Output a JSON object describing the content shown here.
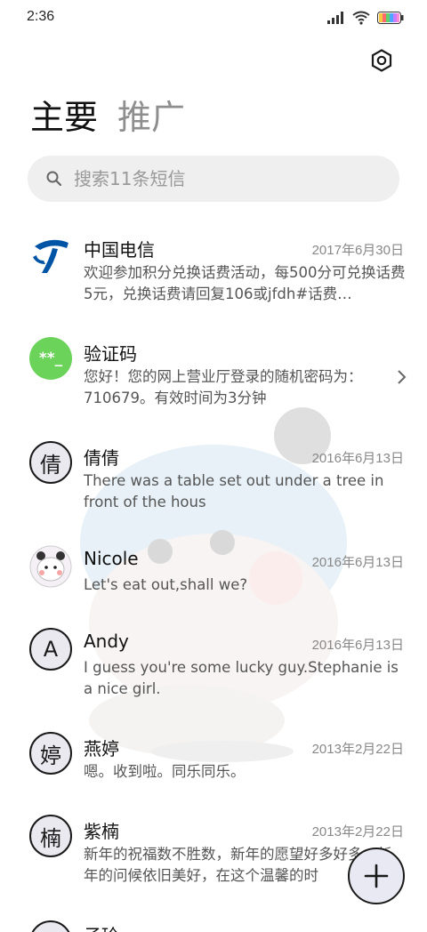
{
  "status_bar": {
    "time": "2:36"
  },
  "tabs": [
    {
      "label": "主要",
      "active": true
    },
    {
      "label": "推广",
      "active": false
    }
  ],
  "search": {
    "placeholder": "搜索11条短信"
  },
  "conversations": [
    {
      "name": "中国电信",
      "date": "2017年6月30日",
      "preview": "欢迎参加积分兑换话费活动，每500分可兑换话费5元，兑换话费请回复106或jfdh#话费…",
      "avatar": "china-telecom-logo-icon"
    },
    {
      "name": "验证码",
      "date": "",
      "preview": "您好！您的网上营业厅登录的随机密码为：710679。有效时间为3分钟",
      "avatar_text": "**_",
      "avatar_color": "#6bd35a"
    },
    {
      "name": "倩倩",
      "date": "2016年6月13日",
      "preview": "There was a table set out under a tree in front of the hous",
      "avatar_text": "倩"
    },
    {
      "name": "Nicole",
      "date": "2016年6月13日",
      "preview": "Let's eat out,shall we?",
      "avatar": "bear-photo-avatar"
    },
    {
      "name": "Andy",
      "date": "2016年6月13日",
      "preview": "I guess you're some lucky guy.Stephanie is a nice girl.",
      "avatar_text": "A"
    },
    {
      "name": "燕婷",
      "date": "2013年2月22日",
      "preview": "嗯。收到啦。同乐同乐。",
      "avatar_text": "婷"
    },
    {
      "name": "紫楠",
      "date": "2013年2月22日",
      "preview": "新年的祝福数不胜数，新年的愿望好多好多，新年的问候依旧美好，在这个温馨的时",
      "avatar_text": "楠"
    },
    {
      "name": "子玲",
      "date": "",
      "preview": "",
      "avatar_text": ""
    }
  ],
  "colors": {
    "accent_green": "#6bd35a",
    "telecom_blue": "#0054a6",
    "avatar_bg": "#e9e9ef"
  }
}
